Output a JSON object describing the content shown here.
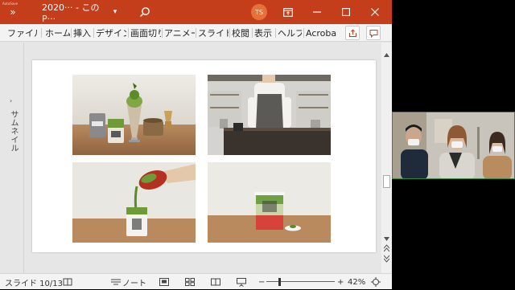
{
  "titlebar": {
    "autosave": "AutoSave",
    "more": "»",
    "filename": "2020··· - この P···",
    "dropdown": "▾",
    "user_initials": "TS",
    "user_color": "#e8703a"
  },
  "ribbon": {
    "tabs": [
      "ファイル",
      "ホーム",
      "挿入",
      "デザイン",
      "画面切り",
      "アニメー",
      "スライド",
      "校閲",
      "表示",
      "ヘルプ",
      "Acroba"
    ]
  },
  "thumbnails": {
    "label": "サムネイル",
    "arrow": "›"
  },
  "status": {
    "slide_info": "スライド 10/13",
    "notes_label": "ノート",
    "zoom_minus": "−",
    "zoom_plus": "+",
    "zoom_value": "42%",
    "zoom_level": 0.42
  },
  "colors": {
    "ppt_accent": "#c43e1c",
    "matcha": "#5b8c2a"
  }
}
